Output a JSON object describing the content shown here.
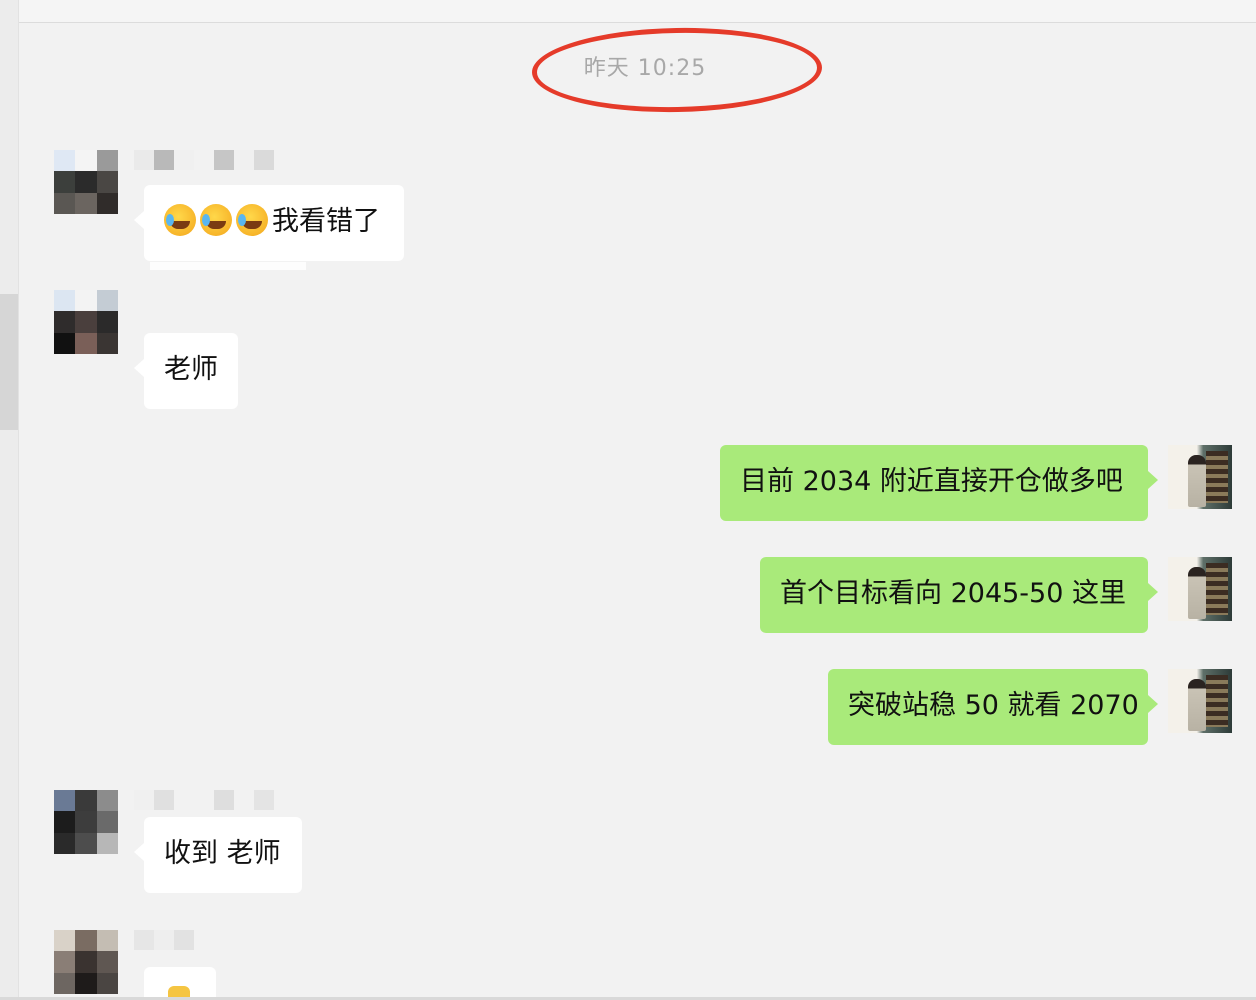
{
  "chat": {
    "timestamp": "昨天 10:25",
    "messages": [
      {
        "side": "left",
        "kind": "emoji-text",
        "emoji_count": 3,
        "emoji_name": "laughing-tears-emoji",
        "text": "我看错了"
      },
      {
        "side": "left",
        "kind": "text",
        "text": "老师"
      },
      {
        "side": "right",
        "kind": "text",
        "text": "目前 2034 附近直接开仓做多吧"
      },
      {
        "side": "right",
        "kind": "text",
        "text": "首个目标看向 2045-50 这里"
      },
      {
        "side": "right",
        "kind": "text",
        "text": "突破站稳 50 就看 2070"
      },
      {
        "side": "left",
        "kind": "text",
        "text": "收到 老师"
      },
      {
        "side": "left",
        "kind": "partial",
        "text": ""
      }
    ]
  },
  "colors": {
    "background": "#f2f2f2",
    "incoming_bubble": "#ffffff",
    "outgoing_bubble": "#a9ea7a",
    "timestamp_text": "#a8a8a8",
    "annotation_circle": "#e53b2a"
  },
  "icons": {
    "incoming_avatar": "pixelated-avatar-icon",
    "outgoing_avatar": "user-photo-avatar-icon",
    "emoji": "laughing-tears-emoji"
  }
}
